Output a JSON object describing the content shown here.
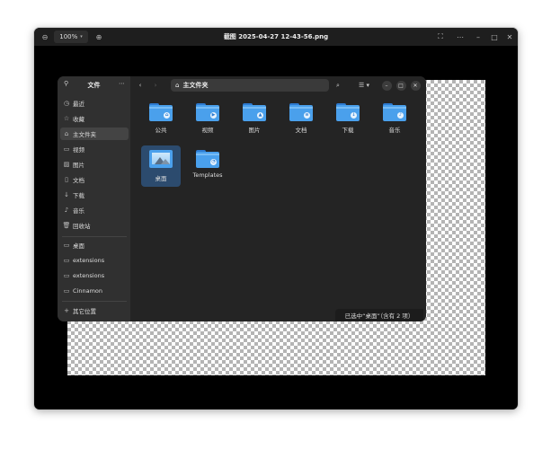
{
  "viewer": {
    "title": "截图 2025-04-27 12-43-56.png",
    "zoom": "100%",
    "icons": [
      "zoom-out-icon",
      "zoom-dropdown-icon",
      "zoom-in-icon",
      "fullscreen-icon",
      "more-icon",
      "minimize-icon",
      "maximize-icon",
      "close-icon"
    ]
  },
  "file_manager": {
    "sidebar": {
      "title": "文件",
      "places": [
        {
          "label": "最近",
          "icon": "recent-icon"
        },
        {
          "label": "收藏",
          "icon": "star-icon"
        },
        {
          "label": "主文件夹",
          "icon": "home-icon",
          "active": true
        },
        {
          "label": "视频",
          "icon": "video-icon"
        },
        {
          "label": "图片",
          "icon": "picture-icon"
        },
        {
          "label": "文档",
          "icon": "document-icon"
        },
        {
          "label": "下载",
          "icon": "download-icon"
        },
        {
          "label": "音乐",
          "icon": "music-icon"
        },
        {
          "label": "回收站",
          "icon": "trash-icon"
        }
      ],
      "bookmarks": [
        {
          "label": "桌面",
          "icon": "desktop-icon"
        },
        {
          "label": "extensions",
          "icon": "folder-icon"
        },
        {
          "label": "extensions",
          "icon": "folder-icon"
        },
        {
          "label": "Cinnamon",
          "icon": "folder-icon"
        }
      ],
      "other_locations": "其它位置"
    },
    "path": "主文件夹",
    "items": [
      {
        "label": "公共",
        "emblem": "share"
      },
      {
        "label": "视频",
        "emblem": "video"
      },
      {
        "label": "图片",
        "emblem": "picture"
      },
      {
        "label": "文档",
        "emblem": "document"
      },
      {
        "label": "下载",
        "emblem": "download"
      },
      {
        "label": "音乐",
        "emblem": "music"
      },
      {
        "label": "桌面",
        "emblem": "desktop",
        "selected": true
      },
      {
        "label": "Templates",
        "emblem": "template"
      }
    ],
    "status": "已选中“桌面”（含有 2 项）"
  },
  "colors": {
    "folder": "#4aa0ec",
    "selection": "#2c4b6e",
    "window_bg": "#242424",
    "sidebar_bg": "#303030"
  }
}
